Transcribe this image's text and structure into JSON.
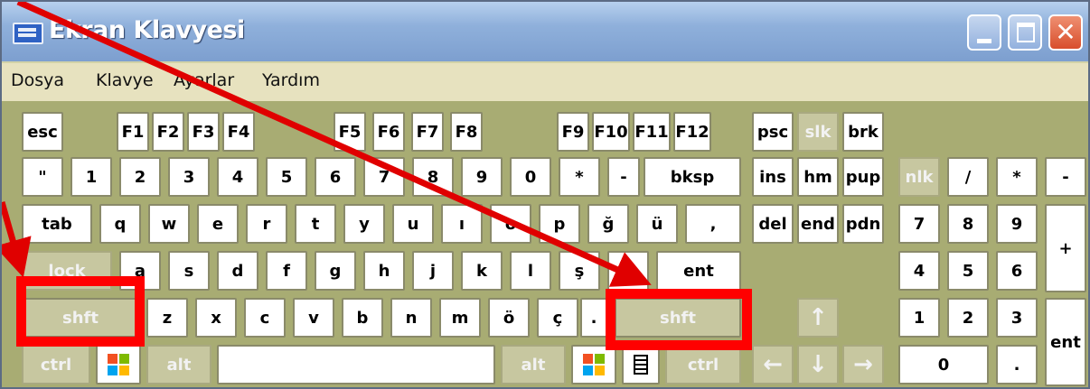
{
  "window": {
    "title": "Ekran Klavyesi",
    "close_glyph": "✕",
    "titlebar_color": "#7d9fcf",
    "close_color": "#d84e2c"
  },
  "menu": [
    "Dosya",
    "Klavye",
    "Ayarlar",
    "Yardım"
  ],
  "keys": {
    "row1": [
      "esc",
      "F1",
      "F2",
      "F3",
      "F4",
      "F5",
      "F6",
      "F7",
      "F8",
      "F9",
      "F10",
      "F11",
      "F12",
      "psc",
      "slk",
      "brk"
    ],
    "row2": [
      "\"",
      "1",
      "2",
      "3",
      "4",
      "5",
      "6",
      "7",
      "8",
      "9",
      "0",
      "*",
      "-",
      "bksp",
      "ins",
      "hm",
      "pup",
      "nlk",
      "/",
      "*",
      "-"
    ],
    "row3": [
      "tab",
      "q",
      "w",
      "e",
      "r",
      "t",
      "y",
      "u",
      "ı",
      "o",
      "p",
      "ğ",
      "ü",
      ",",
      "del",
      "end",
      "pdn",
      "7",
      "8",
      "9",
      "+"
    ],
    "row4": [
      "lock",
      "a",
      "s",
      "d",
      "f",
      "g",
      "h",
      "j",
      "k",
      "l",
      "ş",
      "i",
      "ent",
      "4",
      "5",
      "6"
    ],
    "row5": [
      "shft",
      "z",
      "x",
      "c",
      "v",
      "b",
      "n",
      "m",
      "ö",
      "ç",
      ".",
      "shft",
      "↑",
      "1",
      "2",
      "3",
      "ent"
    ],
    "row6": [
      "ctrl",
      "alt",
      "alt",
      "ctrl",
      "←",
      "↓",
      "→",
      "0",
      "."
    ]
  },
  "icons": [
    "windows-logo-icon",
    "application-menu-icon",
    "arrow-up-icon",
    "arrow-left-icon",
    "arrow-down-icon",
    "arrow-right-icon"
  ],
  "annotations": {
    "color": "#ff0000",
    "highlighted_keys": [
      "left shft",
      "right shft"
    ]
  }
}
